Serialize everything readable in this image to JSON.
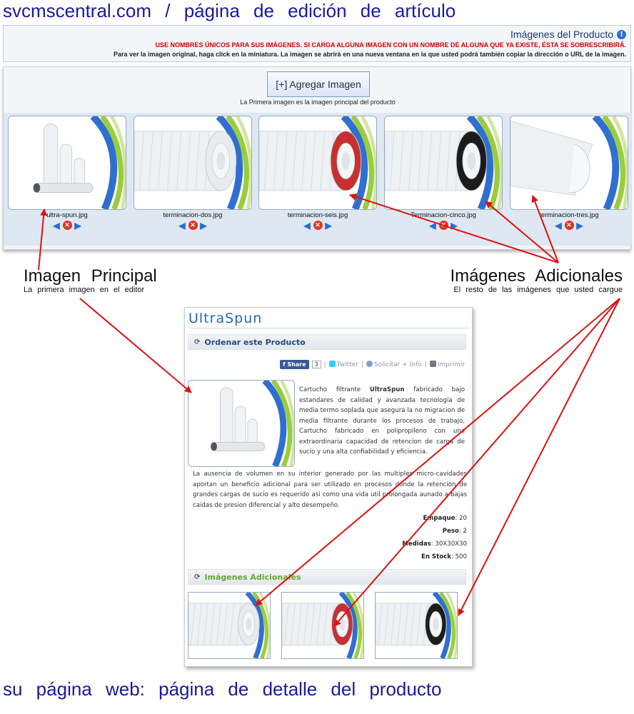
{
  "page_title": "svcmscentral.com / página de edición de artículo",
  "bottom_title": "su página web: página de detalle del producto",
  "info_panel": {
    "heading": "Imágenes del Producto",
    "warning": "USE NOMBRES ÚNICOS PARA SUS IMÁGENES. SI CARGA ALGUNA IMAGEN CON UN NOMBRE DE ALGUNA QUE YA EXISTE, ÉSTA SE SOBRESCRIBIRÁ.",
    "help": "Para ver la imagen original, haga click en la miniatura. La imagen se abrirá en una nueva ventana en la que usted podrá también copiar la dirección o URL de la imagen."
  },
  "editor": {
    "add_button": "[+] Agregar Imagen",
    "hint": "La Primera imagen es la imagen principal del producto",
    "images": [
      {
        "name": "ultra-spun.jpg",
        "type": "group"
      },
      {
        "name": "terminacion-dos.jpg",
        "type": "plain"
      },
      {
        "name": "terminacion-seis.jpg",
        "type": "red"
      },
      {
        "name": "Terminacion-cinco.jpg",
        "type": "black"
      },
      {
        "name": "terminacion-tres.jpg",
        "type": "end"
      }
    ]
  },
  "annotations": {
    "principal_title": "Imagen Principal",
    "principal_sub": "La primera imagen en el editor",
    "adicionales_title": "Imágenes Adicionales",
    "adicionales_sub": "El resto de las imágenes que usted cargue"
  },
  "webpage": {
    "title": "UltraSpun",
    "order_section": "Ordenar este Producto",
    "share": {
      "fb_label": "Share",
      "fb_count": "3",
      "twitter": "Twitter",
      "info": "Solicitar + Info",
      "print": "Imprimir"
    },
    "desc1_pre": "Cartucho filtrante ",
    "desc1_bold": "UltraSpun",
    "desc1_post": " fabricado bajo estandares de calidad y avanzada tecnología de media termo soplada que asegura la no migracion de media filtrante durante los procesos de trabajo, Cartucho fabricado en polipropileno con una extraordinaria capacidad de retencion de carga de sucio y una alta confiabilidad y eficiencia.",
    "desc2": "La ausencia de volumen en su interior generado por las multiples micro-cavidades aportan un beneficio adicional para ser utilizado en procesos donde la retencion de grandes cargas de sucio es requerido asi como una vida util prolongada aunado a bajas caidas de presion diferencial y alto desempeño.",
    "specs": [
      {
        "label": "Empaque",
        "value": "20"
      },
      {
        "label": "Peso",
        "value": "2"
      },
      {
        "label": "Medidas",
        "value": "30X30X30"
      },
      {
        "label": "En Stock",
        "value": "500"
      }
    ],
    "more_section": "Imágenes Adicionales",
    "additional_images": [
      "plain",
      "red",
      "black"
    ]
  },
  "colors": {
    "title_blue": "#1a1a9c",
    "warning_red": "#d40000",
    "arrow_red": "#e01010",
    "product_blue": "#2b67a8",
    "section_green": "#6aa82d"
  }
}
